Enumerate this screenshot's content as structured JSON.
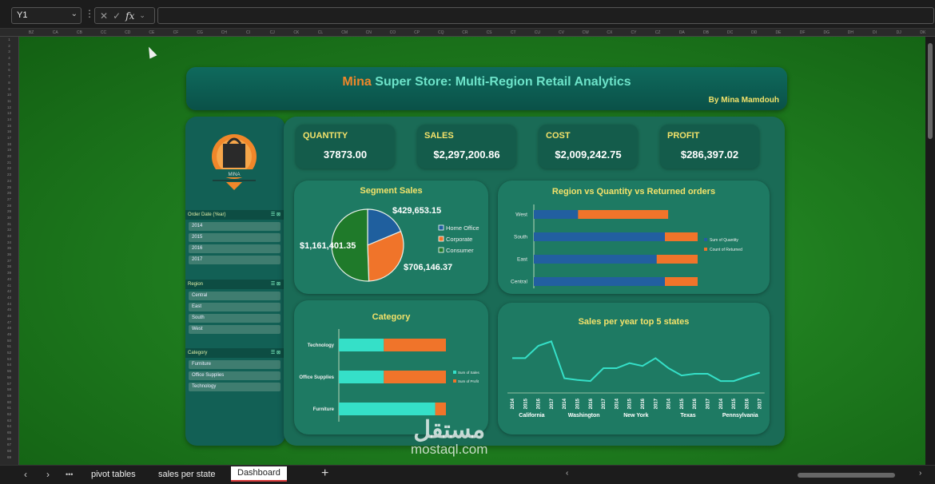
{
  "formula_bar": {
    "name_box": "Y1",
    "fx": "fx"
  },
  "column_headers": [
    "BZ",
    "CA",
    "CB",
    "CC",
    "CD",
    "CE",
    "CF",
    "CG",
    "CH",
    "CI",
    "CJ",
    "CK",
    "CL",
    "CM",
    "CN",
    "CO",
    "CP",
    "CQ",
    "CR",
    "CS",
    "CT",
    "CU",
    "CV",
    "CW",
    "CX",
    "CY",
    "CZ",
    "DA",
    "DB",
    "DC",
    "DD",
    "DE",
    "DF",
    "DG",
    "DH",
    "DI",
    "DJ",
    "DK"
  ],
  "row_count": 69,
  "dashboard": {
    "title_accent": "Mina",
    "title_rest": " Super Store: Multi-Region Retail Analytics",
    "author": "By Mina Mamdouh",
    "logo_text": "MINA",
    "kpis": [
      {
        "label": "QUANTITY",
        "value": "37873.00"
      },
      {
        "label": "SALES",
        "value": "$2,297,200.86"
      },
      {
        "label": "COST",
        "value": "$2,009,242.75"
      },
      {
        "label": "PROFIT",
        "value": "$286,397.02"
      }
    ],
    "slicers": [
      {
        "title": "Order Date (Year)",
        "items": [
          "2014",
          "2015",
          "2016",
          "2017"
        ]
      },
      {
        "title": "Region",
        "items": [
          "Central",
          "East",
          "South",
          "West"
        ]
      },
      {
        "title": "Category",
        "items": [
          "Furniture",
          "Office Supplies",
          "Technology"
        ]
      }
    ],
    "colors": {
      "home_office": "#1f5f9e",
      "corporate": "#f0742a",
      "consumer": "#1f7a2a",
      "qty": "#225fa0",
      "returned": "#f0742a",
      "cat_sales": "#35e0c8",
      "cat_profit": "#f0742a",
      "line": "#35e0c8"
    }
  },
  "chart_data": [
    {
      "type": "pie",
      "title": "Segment Sales",
      "labels": [
        "Home Office",
        "Corporate",
        "Consumer"
      ],
      "values": [
        429653.15,
        706146.37,
        1161401.35
      ],
      "data_labels": [
        "$429,653.15",
        "$706,146.37",
        "$1,161,401.35"
      ],
      "legend": "right"
    },
    {
      "type": "bar",
      "orientation": "horizontal",
      "title": "Region vs Quantity vs Returned orders",
      "categories": [
        "West",
        "South",
        "East",
        "Central"
      ],
      "series": [
        {
          "name": "Sum of Quantity",
          "values": [
            0.27,
            0.8,
            0.75,
            0.8
          ]
        },
        {
          "name": "Count of Returned",
          "values": [
            0.55,
            0.2,
            0.25,
            0.2
          ]
        }
      ],
      "stacked": true,
      "legend": "right"
    },
    {
      "type": "bar",
      "orientation": "horizontal",
      "title": "Category",
      "categories": [
        "Technology",
        "Office Supplies",
        "Furniture"
      ],
      "series": [
        {
          "name": "Sum of Sales",
          "values": [
            0.42,
            0.42,
            0.9
          ]
        },
        {
          "name": "Sum of Profit",
          "values": [
            0.58,
            0.58,
            0.1
          ]
        }
      ],
      "stacked": true,
      "legend": "right"
    },
    {
      "type": "line",
      "title": "Sales per year top 5 states",
      "x": [
        "2014",
        "2015",
        "2016",
        "2017",
        "2014",
        "2015",
        "2016",
        "2017",
        "2014",
        "2015",
        "2016",
        "2017",
        "2014",
        "2015",
        "2016",
        "2017",
        "2014",
        "2015",
        "2016",
        "2017"
      ],
      "groups": [
        "California",
        "Washington",
        "New York",
        "Texas",
        "Pennsylvania"
      ],
      "values": [
        0.58,
        0.58,
        0.8,
        0.88,
        0.22,
        0.19,
        0.17,
        0.4,
        0.4,
        0.49,
        0.44,
        0.58,
        0.4,
        0.27,
        0.3,
        0.3,
        0.17,
        0.17,
        0.25,
        0.32
      ]
    }
  ],
  "tabs": {
    "items": [
      "pivot tables",
      "sales per state",
      "Dashboard"
    ],
    "active": "Dashboard",
    "more": "•••",
    "add": "+"
  },
  "watermark": {
    "arabic": "مستقل",
    "latin": "mostaql.com"
  }
}
